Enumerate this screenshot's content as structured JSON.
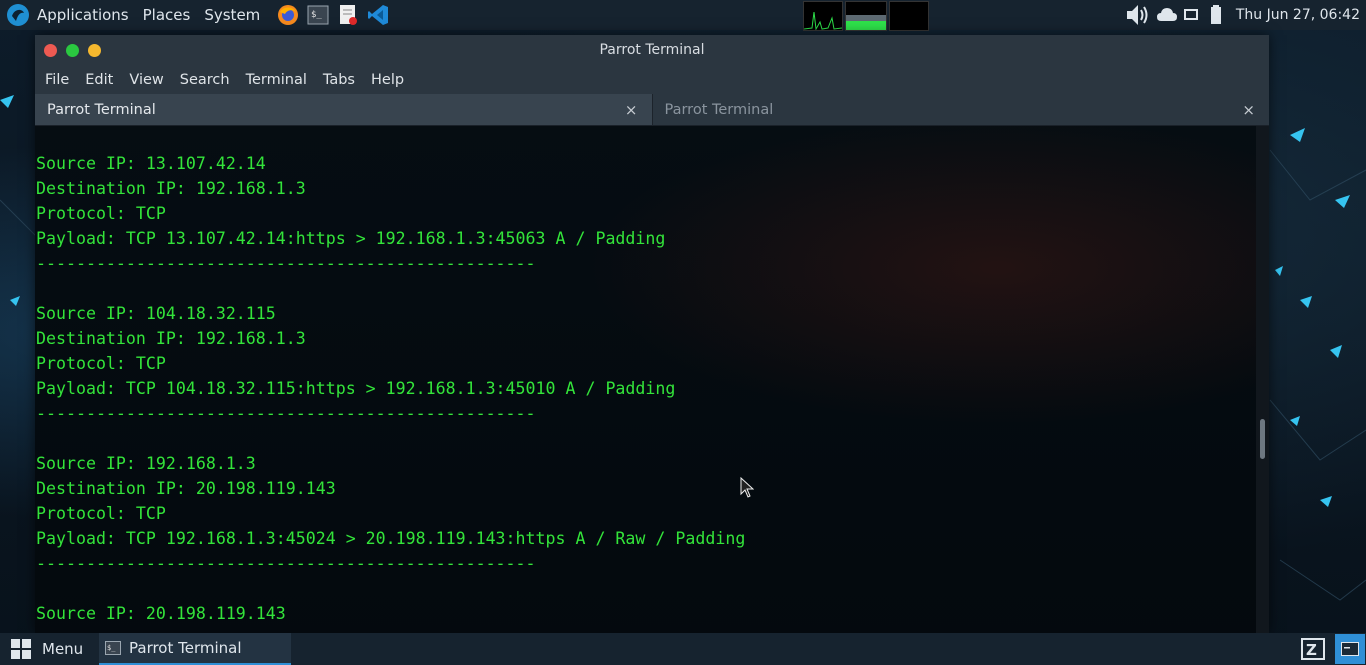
{
  "top_panel": {
    "applications_label": "Applications",
    "places_label": "Places",
    "system_label": "System",
    "launchers": [
      "firefox-icon",
      "terminal-icon",
      "text-editor-icon",
      "vscode-icon"
    ],
    "clock": "Thu Jun 27, 06:42"
  },
  "window": {
    "title": "Parrot Terminal",
    "menu": {
      "file": "File",
      "edit": "Edit",
      "view": "View",
      "search": "Search",
      "terminal": "Terminal",
      "tabs": "Tabs",
      "help": "Help"
    },
    "tabs": [
      {
        "label": "Parrot Terminal",
        "close": "×"
      },
      {
        "label": "Parrot Terminal",
        "close": "×"
      }
    ]
  },
  "terminal": {
    "lines": [
      "Source IP: 13.107.42.14",
      "Destination IP: 192.168.1.3",
      "Protocol: TCP",
      "Payload: TCP 13.107.42.14:https > 192.168.1.3:45063 A / Padding",
      "--------------------------------------------------",
      "",
      "Source IP: 104.18.32.115",
      "Destination IP: 192.168.1.3",
      "Protocol: TCP",
      "Payload: TCP 104.18.32.115:https > 192.168.1.3:45010 A / Padding",
      "--------------------------------------------------",
      "",
      "Source IP: 192.168.1.3",
      "Destination IP: 20.198.119.143",
      "Protocol: TCP",
      "Payload: TCP 192.168.1.3:45024 > 20.198.119.143:https A / Raw / Padding",
      "--------------------------------------------------",
      "",
      "Source IP: 20.198.119.143"
    ],
    "text_color": "#33e43a"
  },
  "bottom_panel": {
    "menu_label": "Menu",
    "task_label": "Parrot Terminal"
  },
  "colors": {
    "close": "#ee5a52",
    "maximize": "#2ac840",
    "minimize": "#f5b82e",
    "accent": "#2f8fd6"
  }
}
